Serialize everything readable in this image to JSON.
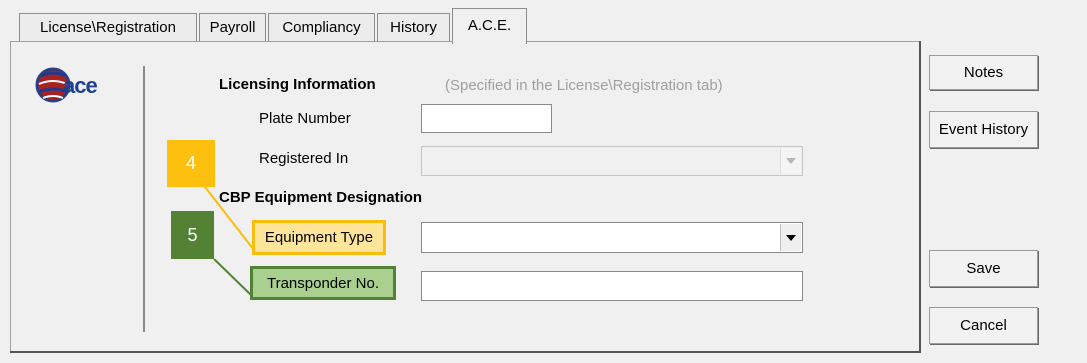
{
  "tabs": [
    {
      "label": "License\\Registration"
    },
    {
      "label": "Payroll"
    },
    {
      "label": "Compliancy"
    },
    {
      "label": "History"
    },
    {
      "label": "A.C.E."
    }
  ],
  "logo": {
    "text": "ace"
  },
  "licensing": {
    "title": "Licensing Information",
    "note": "(Specified in the License\\Registration tab)",
    "plate_label": "Plate Number",
    "plate_value": "",
    "registered_label": "Registered In",
    "registered_value": ""
  },
  "cbp": {
    "title": "CBP Equipment Designation",
    "equipment_label": "Equipment Type",
    "equipment_value": "",
    "transponder_label": "Transponder No.",
    "transponder_value": ""
  },
  "callouts": [
    {
      "number": "4",
      "color": "#fdc00f"
    },
    {
      "number": "5",
      "color": "#548235"
    }
  ],
  "buttons": {
    "notes": "Notes",
    "event_history": "Event History",
    "save": "Save",
    "cancel": "Cancel"
  }
}
